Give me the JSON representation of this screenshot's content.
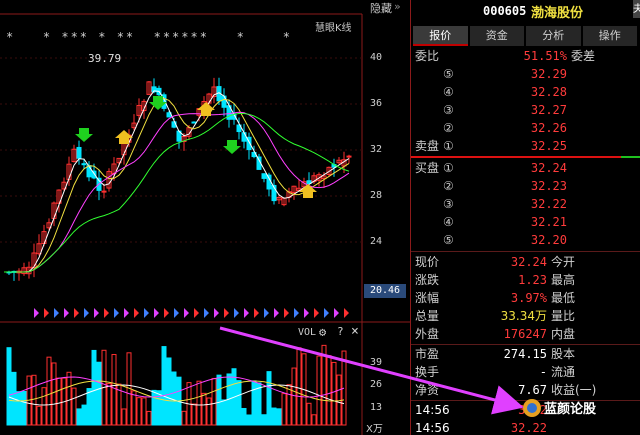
{
  "chart": {
    "hidden_label": "隐藏",
    "hidden_arrows": "》",
    "indicator_label": "慧眼K线",
    "max_price_label": "39.79",
    "price_axis": [
      "40",
      "36",
      "32",
      "28",
      "24"
    ],
    "current_price_tag": "20.46",
    "stars": "*   * *** * **  ******   *    *",
    "vol_label": "VOL",
    "vol_gear": "gear-icon",
    "vol_help": "?",
    "vol_close": "×",
    "vol_axis": [
      "39",
      "26",
      "13"
    ],
    "vol_unit": "X万",
    "colors": {
      "up": "#ff3030",
      "down": "#00e5ff",
      "ma5": "#ffffff",
      "ma10": "#f0e040",
      "ma20": "#ff40ff",
      "ma60": "#30ff30",
      "arrow": "#e040ff"
    }
  },
  "quote": {
    "code": "000605",
    "name": "渤海股份",
    "fold_label": "夬",
    "tabs": [
      "报价",
      "资金",
      "分析",
      "操作"
    ],
    "weibi": {
      "label": "委比",
      "value": "51.51%",
      "label2": "委差"
    },
    "asks": [
      {
        "idx": "⑤",
        "price": "32.29"
      },
      {
        "idx": "④",
        "price": "32.28"
      },
      {
        "idx": "③",
        "price": "32.27"
      },
      {
        "idx": "②",
        "price": "32.26"
      },
      {
        "label": "卖盘",
        "idx": "①",
        "price": "32.25"
      }
    ],
    "bids": [
      {
        "label": "买盘",
        "idx": "①",
        "price": "32.24"
      },
      {
        "idx": "②",
        "price": "32.23"
      },
      {
        "idx": "③",
        "price": "32.22"
      },
      {
        "idx": "④",
        "price": "32.21"
      },
      {
        "idx": "⑤",
        "price": "32.20"
      }
    ],
    "info": [
      {
        "l": "现价",
        "v": "32.24",
        "l2": "今开"
      },
      {
        "l": "涨跌",
        "v": "1.23",
        "l2": "最高"
      },
      {
        "l": "涨幅",
        "v": "3.97%",
        "l2": "最低"
      },
      {
        "l": "总量",
        "v": "33.34万",
        "l2": "量比"
      },
      {
        "l": "外盘",
        "v": "176247",
        "l2": "内盘"
      },
      {
        "l": "市盈",
        "v": "274.15",
        "l2": "股本"
      },
      {
        "l": "换手",
        "v": "-",
        "l2": "流通"
      },
      {
        "l": "净资",
        "v": "7.67",
        "l2": "收益(一)"
      }
    ],
    "ticks": [
      {
        "time": "14:56",
        "price": "32.2"
      },
      {
        "time": "14:56",
        "price": "32.22"
      }
    ]
  },
  "watermark": {
    "text": "蓝颜论股"
  }
}
